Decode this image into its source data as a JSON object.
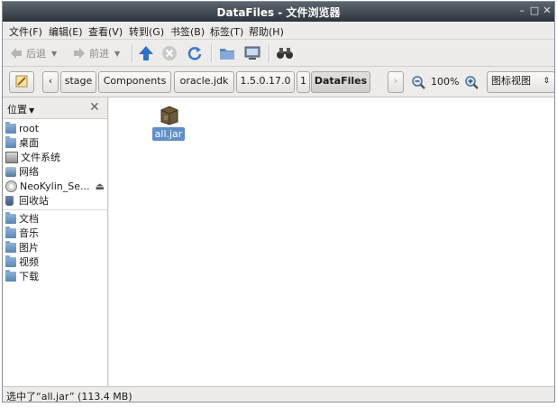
{
  "window": {
    "title": "DataFiles - 文件浏览器"
  },
  "menubar": [
    "文件(F)",
    "编辑(E)",
    "查看(V)",
    "转到(G)",
    "书签(B)",
    "标签(T)",
    "帮助(H)"
  ],
  "toolbar": {
    "back_label": "后退",
    "forward_label": "前进"
  },
  "location": {
    "breadcrumbs": [
      "stage",
      "Components",
      "oracle.jdk",
      "1.5.0.17.0",
      "1",
      "DataFiles"
    ],
    "zoom": "100%",
    "view_mode": "图标视图"
  },
  "sidebar": {
    "header": "位置",
    "places": [
      {
        "label": "root",
        "icon": "folder-icon"
      },
      {
        "label": "桌面",
        "icon": "desktop-folder-icon"
      },
      {
        "label": "文件系统",
        "icon": "drive-icon"
      },
      {
        "label": "网络",
        "icon": "network-icon"
      },
      {
        "label": "NeoKylin_Se...",
        "icon": "disc-icon"
      },
      {
        "label": "回收站",
        "icon": "trash-icon"
      }
    ],
    "bookmarks": [
      {
        "label": "文档",
        "icon": "folder-icon"
      },
      {
        "label": "音乐",
        "icon": "folder-icon"
      },
      {
        "label": "图片",
        "icon": "folder-icon"
      },
      {
        "label": "视频",
        "icon": "folder-icon"
      },
      {
        "label": "下载",
        "icon": "folder-icon"
      }
    ]
  },
  "files": [
    {
      "name": "all.jar",
      "icon": "jar-archive-icon"
    }
  ],
  "status": "选中了“all.jar” (113.4 MB)"
}
